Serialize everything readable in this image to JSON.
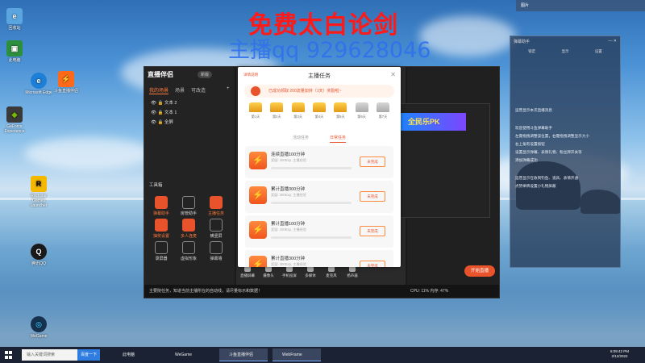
{
  "overlay": {
    "title": "免费太白论剑",
    "subtitle": "主播qq 929628046"
  },
  "desktop_icons": [
    {
      "label": "回收站",
      "icon": "recycle-bin-icon"
    },
    {
      "label": "此电脑",
      "icon": "this-pc-icon"
    },
    {
      "label": "Microsoft Edge",
      "icon": "edge-icon"
    },
    {
      "label": "GeForce Experience",
      "icon": "geforce-icon"
    },
    {
      "label": "Rockstar Games Launcher",
      "icon": "rockstar-icon"
    },
    {
      "label": "腾讯QQ",
      "icon": "qq-icon"
    },
    {
      "label": "斗鱼直播伴侣",
      "icon": "douyu-icon"
    },
    {
      "label": "WeGame",
      "icon": "wegame-icon"
    }
  ],
  "app": {
    "title": "直播伴侣",
    "version_badge": "新版",
    "tabs": [
      "我的场景",
      "场景",
      "可改造"
    ],
    "sources": [
      "文本 2",
      "文本 1",
      "全屏"
    ],
    "tools_title": "工具箱",
    "tools": [
      {
        "label": "弹幕助手",
        "hot": true
      },
      {
        "label": "房管助手",
        "hot": false
      },
      {
        "label": "主播任务",
        "hot": true
      },
      {
        "label": "抽奖设置",
        "hot": false
      },
      {
        "label": "多人连麦",
        "hot": false
      },
      {
        "label": "横竖屏",
        "hot": false
      },
      {
        "label": "录屏器",
        "hot": false
      },
      {
        "label": "虚拟形象",
        "hot": false
      },
      {
        "label": "弹幕墙",
        "hot": false
      }
    ],
    "bottom_tools": [
      "直播屏幕",
      "摄像头",
      "手机投屏",
      "多媒体",
      "麦克风",
      "扬声器"
    ],
    "start_button": "开始直播",
    "footer_notice": "主要院任务，知道当前主播所在的自动线，请尽量标示和数据！",
    "stats": "CPU: 11% 内存: 47%"
  },
  "pk_banner": "全民乐PK",
  "modal": {
    "tag": "详情说明",
    "title": "主播任务",
    "notice": "已成功领取 200流量加持（1天）奖励啦~",
    "chests": [
      {
        "day": "第1天",
        "active": true
      },
      {
        "day": "第2天",
        "active": true
      },
      {
        "day": "第3天",
        "active": true
      },
      {
        "day": "第4天",
        "active": true
      },
      {
        "day": "第5天",
        "active": true
      },
      {
        "day": "第6天",
        "active": false
      },
      {
        "day": "第7天",
        "active": false
      }
    ],
    "tabs": [
      "活动任务",
      "日常任务"
    ],
    "tasks": [
      {
        "name": "连续直播100分钟",
        "sub": "奖励: 100Exp, 主播经验",
        "button": "未完成",
        "progress": 0
      },
      {
        "name": "累计直播300分钟",
        "sub": "奖励: 300Exp, 主播经验",
        "button": "未完成",
        "progress": 0
      },
      {
        "name": "累计直播100分钟",
        "sub": "奖励: 100Exp, 主播经验",
        "button": "未完成",
        "progress": 0
      },
      {
        "name": "累计直播300分钟",
        "sub": "奖励: 300Exp, 主播经验",
        "button": "未完成",
        "progress": 0
      }
    ]
  },
  "right_panel": {
    "title": "弹幕助手",
    "buttons": [
      "锁定",
      "显示",
      "设置"
    ],
    "lines": [
      "运营显示本次直播消息",
      "欢迎使用斗鱼弹幕助手",
      "左键拖拽调整该位置，右键拖拽调整显示大小",
      "右上角有设置按钮",
      "设置显示弹幕、表情礼物、粉丝牌开关等",
      "添加弹幕成功",
      "运营显示在收到钓鱼、道具、表情开通",
      "点赞举牌设置小礼物屏蔽"
    ]
  },
  "top_bar": "图片",
  "taskbar": {
    "search_placeholder": "输入关键词搜索",
    "search_button": "百度一下",
    "items": [
      {
        "label": "此电脑",
        "active": false
      },
      {
        "label": "WeGame",
        "active": false
      },
      {
        "label": "斗鱼直播伴侣",
        "active": true
      },
      {
        "label": "WebFrame",
        "active": true
      }
    ],
    "time": "6:09:42 PM",
    "date": "2/12/2022"
  },
  "colors": {
    "accent": "#e8532b",
    "overlay_red": "#ff1a1a",
    "overlay_blue": "#2d6ff0"
  }
}
